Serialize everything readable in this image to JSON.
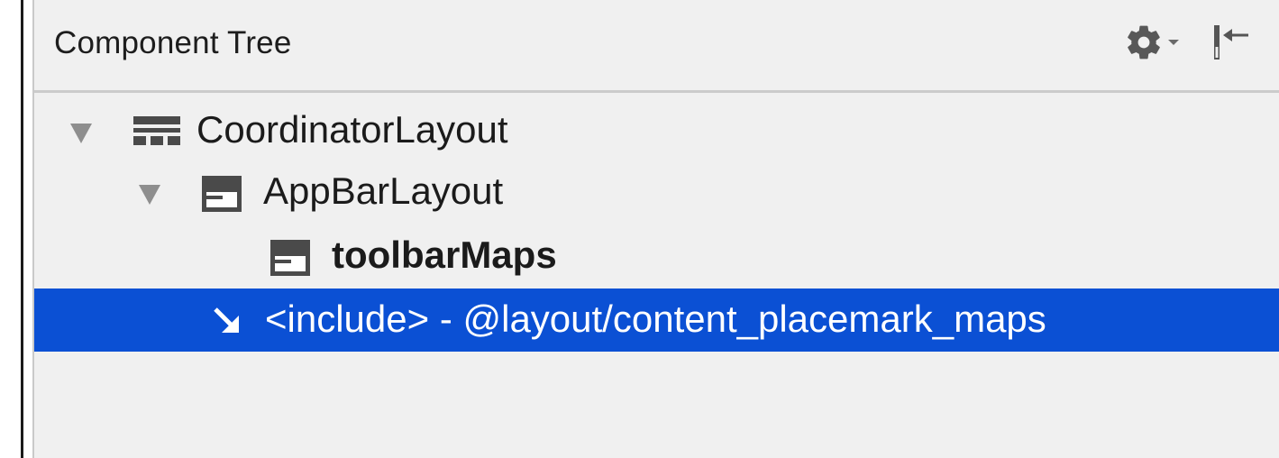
{
  "panel": {
    "title": "Component Tree"
  },
  "header_actions": {
    "settings_icon": "gear-icon",
    "settings_dropdown_icon": "chevron-down-icon",
    "collapse_icon": "collapse-panel-icon"
  },
  "tree": {
    "nodes": [
      {
        "label": "CoordinatorLayout",
        "icon": "coordinator-layout-icon",
        "expanded": true,
        "bold": false
      },
      {
        "label": "AppBarLayout",
        "icon": "appbar-layout-icon",
        "expanded": true,
        "bold": false
      },
      {
        "label": "toolbarMaps",
        "icon": "toolbar-icon",
        "bold": true
      },
      {
        "label": "<include> - @layout/content_placemark_maps",
        "icon": "include-arrow-icon",
        "selected": true,
        "bold": false
      }
    ]
  },
  "colors": {
    "selection": "#0b50d4",
    "panel_bg": "#f0f0f0",
    "text": "#1b1b1b",
    "icon_gray": "#4a4a4a"
  }
}
